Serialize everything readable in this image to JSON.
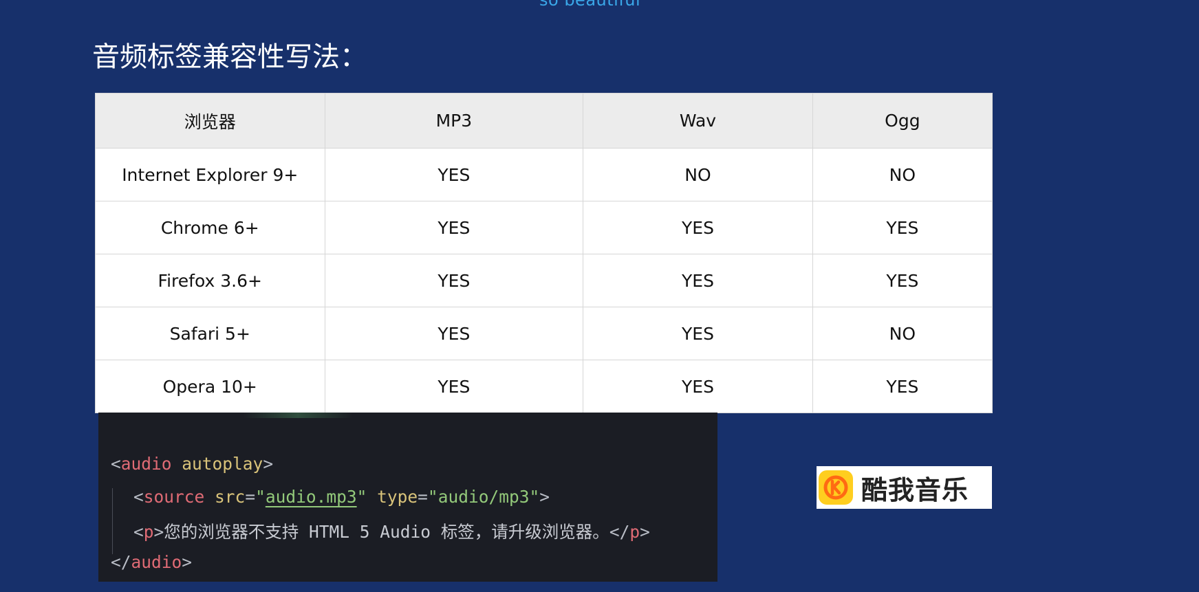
{
  "top_caption": "so beautiful",
  "page_title": "音频标签兼容性写法：",
  "table": {
    "headers": [
      "浏览器",
      "MP3",
      "Wav",
      "Ogg"
    ],
    "rows": [
      [
        "Internet Explorer 9+",
        "YES",
        "NO",
        "NO"
      ],
      [
        "Chrome 6+",
        "YES",
        "YES",
        "YES"
      ],
      [
        "Firefox 3.6+",
        "YES",
        "YES",
        "YES"
      ],
      [
        "Safari 5+",
        "YES",
        "YES",
        "NO"
      ],
      [
        "Opera 10+",
        "YES",
        "YES",
        "YES"
      ]
    ]
  },
  "code": {
    "lt": "<",
    "gt": ">",
    "close_open": "</",
    "eq": "=",
    "q": "\"",
    "audio_tag": "audio",
    "autoplay_attr": "autoplay",
    "source_tag": "source",
    "src_attr": "src",
    "src_value": "audio.mp3",
    "type_attr": "type",
    "type_value": "audio/mp3",
    "p_tag": "p",
    "fallback_text": "您的浏览器不支持 HTML 5 Audio 标签，请升级浏览器。"
  },
  "logo": {
    "icon": "kuwo-music-icon",
    "text": "酷我音乐",
    "colors": {
      "icon_bg": "#ffce1f",
      "icon_ring": "#ff6a13"
    }
  },
  "colors": {
    "background": "#17306b",
    "caption": "#3aa7e8",
    "code_bg": "#1b1d24",
    "code_tag": "#e06b75",
    "code_attr": "#d9c37a",
    "code_string": "#93c97a"
  }
}
